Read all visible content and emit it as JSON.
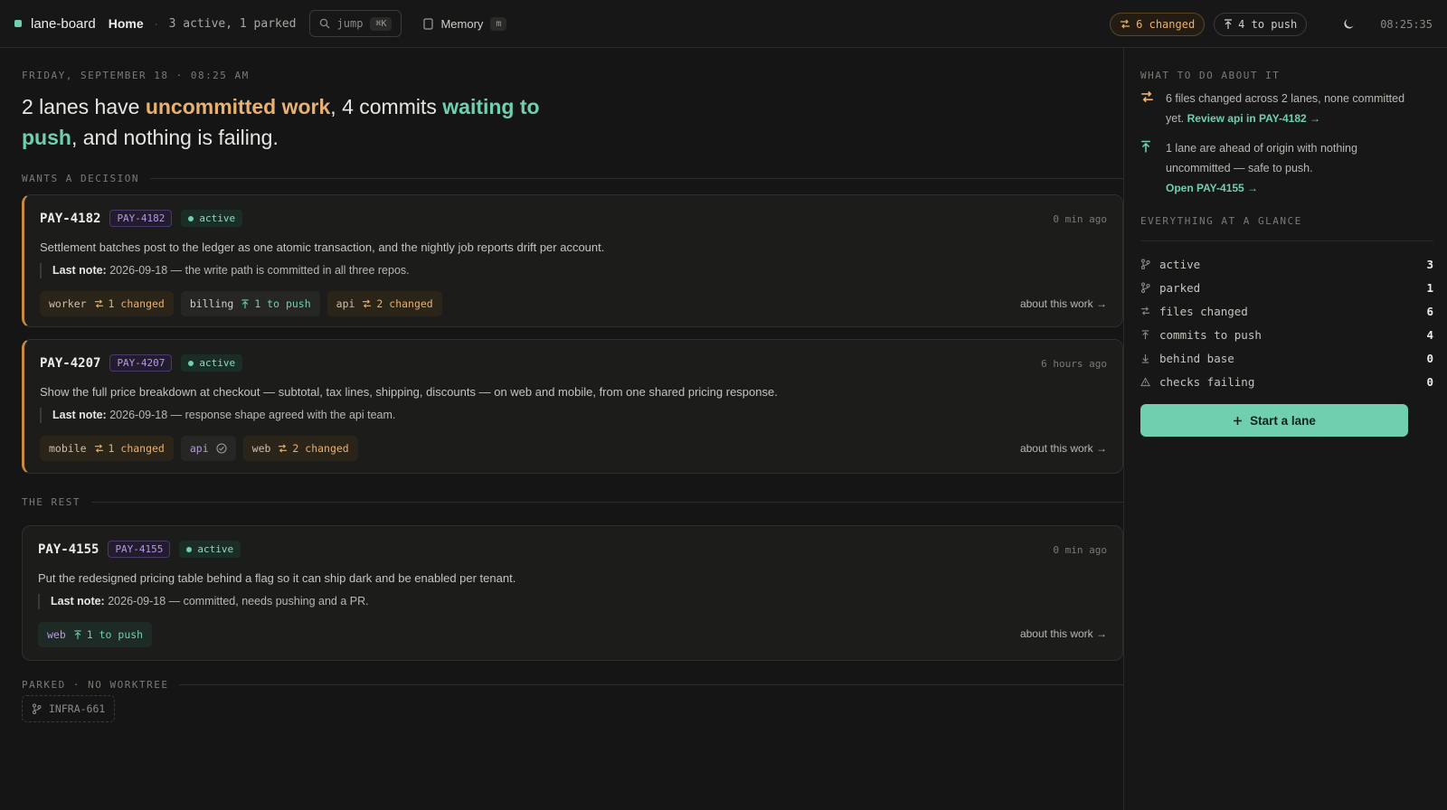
{
  "topbar": {
    "app_title": "lane-board",
    "home_label": "Home",
    "summary": "3 active, 1 parked",
    "jump_placeholder": "jump",
    "jump_shortcut": "⌘K",
    "memory_label": "Memory",
    "memory_shortcut": "m",
    "changed_pill": "6 changed",
    "push_pill": "4 to push",
    "clock": "08:25:35"
  },
  "main": {
    "dateline": "FRIDAY, SEPTEMBER 18 · 08:25 AM",
    "headline": {
      "part1": "2 lanes have ",
      "highlight1": "uncommitted work",
      "part2": ", 4 commits ",
      "highlight2": "waiting to push",
      "part3": ", and nothing is failing."
    },
    "sections": {
      "decision": "WANTS A DECISION",
      "rest": "THE REST",
      "parked": "PARKED · NO WORKTREE"
    },
    "note_label": "Last note:",
    "about_label": "about this work →",
    "cards": [
      {
        "title": "PAY-4182",
        "id": "PAY-4182",
        "status": "active",
        "time": "0 min ago",
        "desc": "Settlement batches post to the ledger as one atomic transaction, and the nightly job reports drift per account.",
        "note": "2026-09-18 — the write path is committed in all three repos.",
        "repos": [
          {
            "name": "worker",
            "stat": "1 changed",
            "kind": "changed"
          },
          {
            "name": "billing",
            "stat": "1 to push",
            "kind": "push"
          },
          {
            "name": "api",
            "stat": "2 changed",
            "kind": "changed"
          }
        ]
      },
      {
        "title": "PAY-4207",
        "id": "PAY-4207",
        "status": "active",
        "time": "6 hours ago",
        "desc": "Show the full price breakdown at checkout — subtotal, tax lines, shipping, discounts — on web and mobile, from one shared pricing response.",
        "note": "2026-09-18 — response shape agreed with the api team.",
        "repos": [
          {
            "name": "mobile",
            "stat": "1 changed",
            "kind": "changed"
          },
          {
            "name": "api",
            "stat": "",
            "kind": "clean"
          },
          {
            "name": "web",
            "stat": "2 changed",
            "kind": "changed"
          }
        ]
      },
      {
        "title": "PAY-4155",
        "id": "PAY-4155",
        "status": "active",
        "time": "0 min ago",
        "desc": "Put the redesigned pricing table behind a flag so it can ship dark and be enabled per tenant.",
        "note": "2026-09-18 — committed, needs pushing and a PR.",
        "repos": [
          {
            "name": "web",
            "stat": "1 to push",
            "kind": "push"
          }
        ]
      }
    ],
    "parked": [
      {
        "name": "INFRA-661"
      }
    ]
  },
  "side": {
    "advice_label": "WHAT TO DO ABOUT IT",
    "advice": [
      {
        "text": "6 files changed across 2 lanes, none committed yet. ",
        "link": "Review api in PAY-4182 →"
      },
      {
        "text": "1 lane are ahead of origin with nothing uncommitted — safe to push.",
        "link": "Open PAY-4155 →"
      }
    ],
    "glance_label": "EVERYTHING AT A GLANCE",
    "glance": [
      {
        "label": "active",
        "value": "3",
        "icon": "branch-icon"
      },
      {
        "label": "parked",
        "value": "1",
        "icon": "branch-icon"
      },
      {
        "label": "files changed",
        "value": "6",
        "icon": "diff-icon"
      },
      {
        "label": "commits to push",
        "value": "4",
        "icon": "arrow-up-icon"
      },
      {
        "label": "behind base",
        "value": "0",
        "icon": "arrow-down-icon"
      },
      {
        "label": "checks failing",
        "value": "0",
        "icon": "warning-icon"
      }
    ],
    "start_button": "Start a lane"
  },
  "colors": {
    "accent_green": "#6fcfae",
    "accent_orange": "#e8b16f",
    "id_purple": "#b49be0",
    "background": "#151515"
  }
}
